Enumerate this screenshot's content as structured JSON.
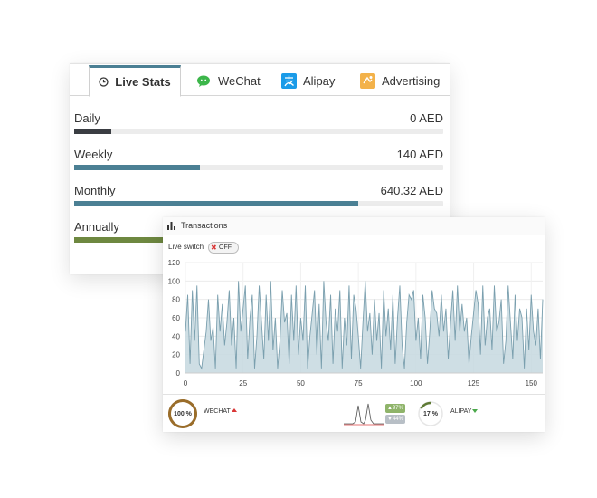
{
  "tabs": [
    {
      "label": "Live Stats",
      "icon": "clock-icon",
      "active": true
    },
    {
      "label": "WeChat",
      "icon": "wechat-icon",
      "active": false
    },
    {
      "label": "Alipay",
      "icon": "alipay-icon",
      "active": false
    },
    {
      "label": "Advertising",
      "icon": "advertising-icon",
      "active": false
    }
  ],
  "stats": [
    {
      "label": "Daily",
      "value": "0 AED",
      "fill": 0.1,
      "color": "#3a3d42"
    },
    {
      "label": "Weekly",
      "value": "140 AED",
      "fill": 0.34,
      "color": "#4b8094"
    },
    {
      "label": "Monthly",
      "value": "640.32 AED",
      "fill": 0.77,
      "color": "#4b8094"
    },
    {
      "label": "Annually",
      "value": "",
      "fill": 1.0,
      "color": "#6e8840"
    }
  ],
  "transactions": {
    "title": "Transactions",
    "live_switch_label": "Live switch",
    "toggle_label": "OFF"
  },
  "chart_data": {
    "type": "area",
    "xlim": [
      0,
      155
    ],
    "ylim": [
      0,
      120
    ],
    "x_ticks": [
      0,
      25,
      50,
      75,
      100,
      125,
      150
    ],
    "y_ticks": [
      0,
      20,
      40,
      60,
      80,
      100,
      120
    ],
    "grid": true,
    "line_color": "#7a9fae",
    "fill_color": "#c6d8df",
    "values": [
      45,
      85,
      10,
      90,
      35,
      95,
      10,
      5,
      25,
      45,
      80,
      35,
      50,
      5,
      85,
      45,
      75,
      30,
      55,
      90,
      30,
      60,
      5,
      100,
      45,
      70,
      95,
      15,
      60,
      85,
      5,
      40,
      95,
      55,
      15,
      85,
      35,
      100,
      25,
      60,
      5,
      35,
      90,
      55,
      65,
      10,
      85,
      35,
      95,
      20,
      60,
      35,
      95,
      5,
      40,
      65,
      90,
      20,
      75,
      5,
      100,
      55,
      35,
      85,
      10,
      70,
      45,
      90,
      5,
      60,
      30,
      95,
      15,
      85,
      70,
      40,
      5,
      55,
      100,
      45,
      65,
      20,
      80,
      35,
      65,
      5,
      90,
      40,
      70,
      25,
      85,
      10,
      60,
      95,
      30,
      5,
      55,
      85,
      80,
      90,
      35,
      60,
      15,
      85,
      60,
      10,
      45,
      90,
      70,
      65,
      40,
      85,
      45,
      70,
      15,
      55,
      90,
      35,
      95,
      45,
      75,
      45,
      60,
      10,
      40,
      65,
      90,
      75,
      20,
      95,
      30,
      60,
      70,
      25,
      95,
      45,
      55,
      80,
      10,
      35,
      95,
      55,
      15,
      85,
      35,
      70,
      60,
      5,
      70,
      25,
      85,
      45,
      30,
      70,
      15,
      80
    ]
  },
  "wechat": {
    "gauge_text": "100 %",
    "gauge_fraction": 1.0,
    "label": "WECHAT",
    "gauge_color": "#9a6d2a",
    "badge_up": "97%",
    "badge_down": "44%"
  },
  "alipay": {
    "gauge_text": "17 %",
    "gauge_fraction": 0.17,
    "label": "ALIPAY",
    "gauge_color": "#5e7a34"
  }
}
